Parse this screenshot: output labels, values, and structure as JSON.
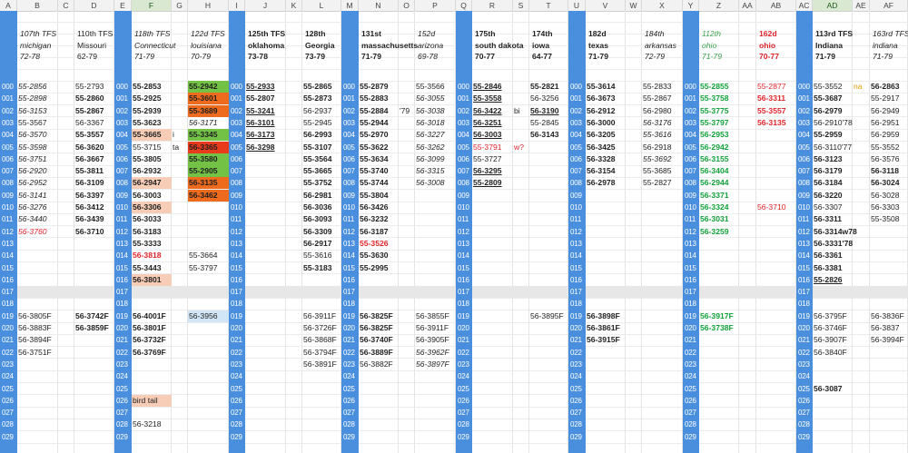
{
  "sheet": {
    "column_letters": [
      "A",
      "B",
      "C",
      "D",
      "E",
      "F",
      "G",
      "H",
      "I",
      "J",
      "K",
      "L",
      "M",
      "N",
      "O",
      "P",
      "Q",
      "R",
      "S",
      "T",
      "U",
      "V",
      "W",
      "X",
      "Y",
      "Z",
      "AA",
      "AB",
      "AC",
      "AD",
      "AE",
      "AF"
    ],
    "row_labels": [
      "000",
      "001",
      "002",
      "003",
      "004",
      "005",
      "006",
      "007",
      "008",
      "009",
      "010",
      "011",
      "012",
      "013",
      "014",
      "015",
      "016",
      "017",
      "018",
      "019",
      "020",
      "021",
      "022",
      "023",
      "024",
      "025",
      "026",
      "027",
      "028",
      "029"
    ],
    "headers": [
      {
        "lines": [
          "107th TFS",
          "michigan",
          "72-78"
        ]
      },
      {
        "lines": [
          "110th TFS",
          "Missouri",
          "62-79"
        ]
      },
      {
        "lines": [
          "118th TFS",
          "Connecticut",
          "71-79"
        ]
      },
      {
        "lines": [
          "122d TFS",
          "louisiana",
          "70-79"
        ]
      },
      {
        "lines": [
          "125th TFS",
          "oklahoma",
          "73-78"
        ]
      },
      {
        "lines": [
          "128th",
          "Georgia",
          "73-79"
        ]
      },
      {
        "lines": [
          "131st",
          "massachusetts",
          "71-79"
        ]
      },
      {
        "lines": [
          "152d",
          "arizona",
          "69-78"
        ]
      },
      {
        "lines": [
          "175th",
          "south dakota",
          "70-77"
        ]
      },
      {
        "lines": [
          "174th",
          "iowa",
          "64-77"
        ]
      },
      {
        "lines": [
          "182d",
          "texas",
          "71-79"
        ]
      },
      {
        "lines": [
          "184th",
          "arkansas",
          "72-79"
        ]
      },
      {
        "lines": [
          "112th",
          "ohio",
          "71-79"
        ]
      },
      {
        "lines": [
          "162d",
          "ohio",
          "70-77"
        ]
      },
      {
        "lines": [
          "113rd TFS",
          "Indiana",
          "71-79"
        ]
      },
      {
        "lines": [
          "163rd TFS",
          "indiana",
          "71-79"
        ]
      }
    ],
    "cells": {
      "B": {
        "0": "55-2856",
        "1": "55-2898",
        "2": "56-3153",
        "3": "55-3567",
        "4": "56-3570",
        "5": "55-3598",
        "6": "56-3751",
        "7": "56-2920",
        "8": "56-2952",
        "9": "56-3141",
        "10": "56-3276",
        "11": "56-3440",
        "12": "56-3760",
        "19": "56-3805F",
        "20": "56-3883F",
        "21": "56-3894F",
        "22": "56-3751F"
      },
      "D": {
        "0": "55-2793",
        "1": "55-2860",
        "2": "55-2867",
        "3": "56-3367",
        "4": "55-3557",
        "5": "56-3620",
        "6": "56-3667",
        "7": "55-3811",
        "8": "56-3109",
        "9": "56-3397",
        "10": "56-3412",
        "11": "56-3439",
        "12": "56-3710",
        "19": "56-3742F",
        "20": "56-3859F"
      },
      "F": {
        "0": "55-2853",
        "1": "55-2925",
        "2": "55-2939",
        "3": "55-3623",
        "4": "55-3665",
        "5": "55-3715",
        "6": "55-3805",
        "7": "56-2932",
        "8": "56-2947",
        "9": "56-3003",
        "10": "56-3306",
        "11": "56-3033",
        "12": "56-3183",
        "13": "55-3333",
        "14": "56-3818",
        "15": "55-3443",
        "16": "56-3801",
        "19": "56-4001F",
        "20": "56-3801F",
        "21": "56-3732F",
        "22": "56-3769F",
        "26": "bird tail",
        "28": "56-3218"
      },
      "G": {
        "4": "i",
        "5": "ta"
      },
      "H": {
        "0": "55-2942",
        "1": "55-3601",
        "2": "55-3689",
        "3": "56-3171",
        "4": "55-3345",
        "5": "56-3365",
        "6": "55-3580",
        "7": "55-2905",
        "8": "56-3135",
        "9": "56-3462",
        "14": "55-3664",
        "15": "55-3797",
        "19": "56-3956"
      },
      "J": {
        "0": "55-2933",
        "1": "55-2807",
        "2": "55-3241",
        "3": "56-3101",
        "4": "56-3173",
        "5": "56-3298"
      },
      "L": {
        "0": "55-2865",
        "1": "55-2873",
        "2": "56-2937",
        "3": "55-2945",
        "4": "56-2993",
        "5": "55-3107",
        "6": "55-3564",
        "7": "55-3665",
        "8": "55-3752",
        "9": "56-2981",
        "10": "56-3036",
        "11": "56-3093",
        "12": "56-3309",
        "13": "56-2917",
        "14": "55-3616",
        "15": "55-3183",
        "19": "56-3911F",
        "20": "56-3726F",
        "21": "56-3868F",
        "22": "56-3794F",
        "23": "56-3891F"
      },
      "N": {
        "0": "55-2879",
        "1": "55-2883",
        "2": "55-2884",
        "3": "55-2944",
        "4": "55-2970",
        "5": "55-3622",
        "6": "55-3634",
        "7": "55-3740",
        "8": "55-3744",
        "9": "55-3804",
        "10": "56-3426",
        "11": "56-3232",
        "12": "56-3187",
        "13": "55-3526",
        "14": "55-3630",
        "15": "55-2995",
        "19": "56-3825F",
        "20": "56-3825F",
        "21": "56-3740F",
        "22": "56-3889F",
        "23": "56-3882F"
      },
      "O": {
        "2": "'79"
      },
      "P": {
        "0": "55-3566",
        "1": "56-3055",
        "2": "56-3038",
        "3": "56-3018",
        "4": "56-3227",
        "5": "56-3262",
        "6": "56-3099",
        "7": "56-3315",
        "8": "56-3008",
        "19": "56-3855F",
        "20": "56-3911F",
        "21": "56-3905F",
        "22": "56-3962F",
        "23": "56-3897F"
      },
      "R": {
        "0": "55-2846",
        "1": "55-3558",
        "2": "56-3422",
        "3": "56-3251",
        "4": "56-3003",
        "5": "55-3791",
        "6": "55-3727",
        "7": "56-3295",
        "8": "55-2809"
      },
      "S": {
        "2": "bi",
        "5": "w?"
      },
      "T": {
        "0": "55-2821",
        "1": "56-3256",
        "2": "56-3190",
        "3": "55-2845",
        "4": "56-3143",
        "19": "56-3895F"
      },
      "V": {
        "0": "55-3614",
        "1": "56-3673",
        "2": "56-2912",
        "3": "56-3000",
        "4": "56-3205",
        "5": "56-3425",
        "6": "56-3328",
        "7": "56-3154",
        "8": "56-2978",
        "19": "56-3898F",
        "20": "56-3861F",
        "21": "56-3915F"
      },
      "X": {
        "0": "55-2833",
        "1": "55-2867",
        "2": "56-2980",
        "3": "56-3176",
        "4": "55-3616",
        "5": "56-2918",
        "6": "55-3692",
        "7": "55-3685",
        "8": "55-2827"
      },
      "Z": {
        "0": "55-2855",
        "1": "55-3758",
        "2": "55-3775",
        "3": "55-3797",
        "4": "56-2953",
        "5": "56-2942",
        "6": "56-3155",
        "7": "56-3404",
        "8": "56-2944",
        "9": "56-3371",
        "10": "56-3324",
        "11": "56-3031",
        "12": "56-3259",
        "19": "56-3917F",
        "20": "56-3738F"
      },
      "AB": {
        "0": "55-2877",
        "1": "56-3311",
        "2": "55-3557",
        "3": "56-3135",
        "10": "56-3710"
      },
      "AD": {
        "0": "55-3552",
        "1": "55-3687",
        "2": "56-2979",
        "3": "56-2910'78",
        "4": "55-2959",
        "5": "56-3110'77",
        "6": "56-3123",
        "7": "56-3179",
        "8": "56-3184",
        "9": "56-3220",
        "10": "56-3307",
        "11": "56-3311",
        "12": "56-3314w78",
        "13": "56-3331'78",
        "14": "56-3361",
        "15": "56-3381",
        "16": "55-2826",
        "19": "56-3795F",
        "20": "56-3746F",
        "21": "56-3907F",
        "22": "56-3840F",
        "25": "56-3087"
      },
      "AE": {
        "0": "na"
      },
      "AF": {
        "0": "56-2863",
        "1": "55-2917",
        "2": "56-2949",
        "3": "56-2951",
        "4": "56-2959",
        "5": "55-3552",
        "6": "56-3576",
        "7": "56-3118",
        "8": "56-3024",
        "9": "56-3028",
        "10": "56-3303",
        "11": "55-3508",
        "19": "56-3836F",
        "20": "56-3837",
        "21": "56-3994F"
      }
    }
  }
}
